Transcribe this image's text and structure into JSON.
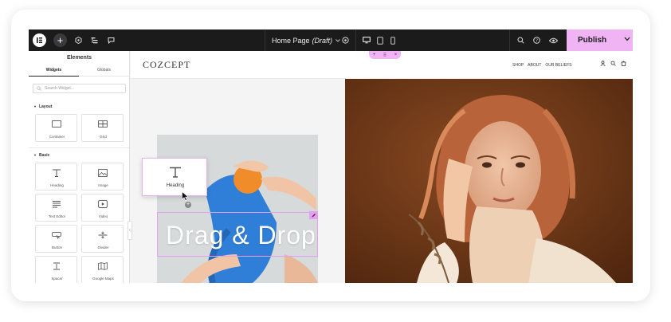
{
  "editor": {
    "page_title": "Home Page",
    "page_status": "(Draft)",
    "publish_label": "Publish"
  },
  "sidebar": {
    "title": "Elements",
    "tabs": [
      "Widgets",
      "Globals"
    ],
    "search_placeholder": "Search Widget...",
    "sections": [
      {
        "label": "Layout",
        "widgets": [
          "Container",
          "Grid"
        ]
      },
      {
        "label": "Basic",
        "widgets": [
          "Heading",
          "Image",
          "Text Editor",
          "Video",
          "Button",
          "Divider",
          "Spacer",
          "Google Maps"
        ]
      }
    ]
  },
  "site": {
    "brand": "COZCEPT",
    "nav": [
      "SHOP",
      "ABOUT",
      "OUR BELIEFS"
    ]
  },
  "canvas": {
    "dragging_widget_label": "Heading",
    "headline": "Drag & Drop"
  },
  "colors": {
    "topbar": "#1b1b1c",
    "publish_accent": "#f0b4f4",
    "selection_outline": "#e3a0ee",
    "photo_background": "#6a3414"
  }
}
